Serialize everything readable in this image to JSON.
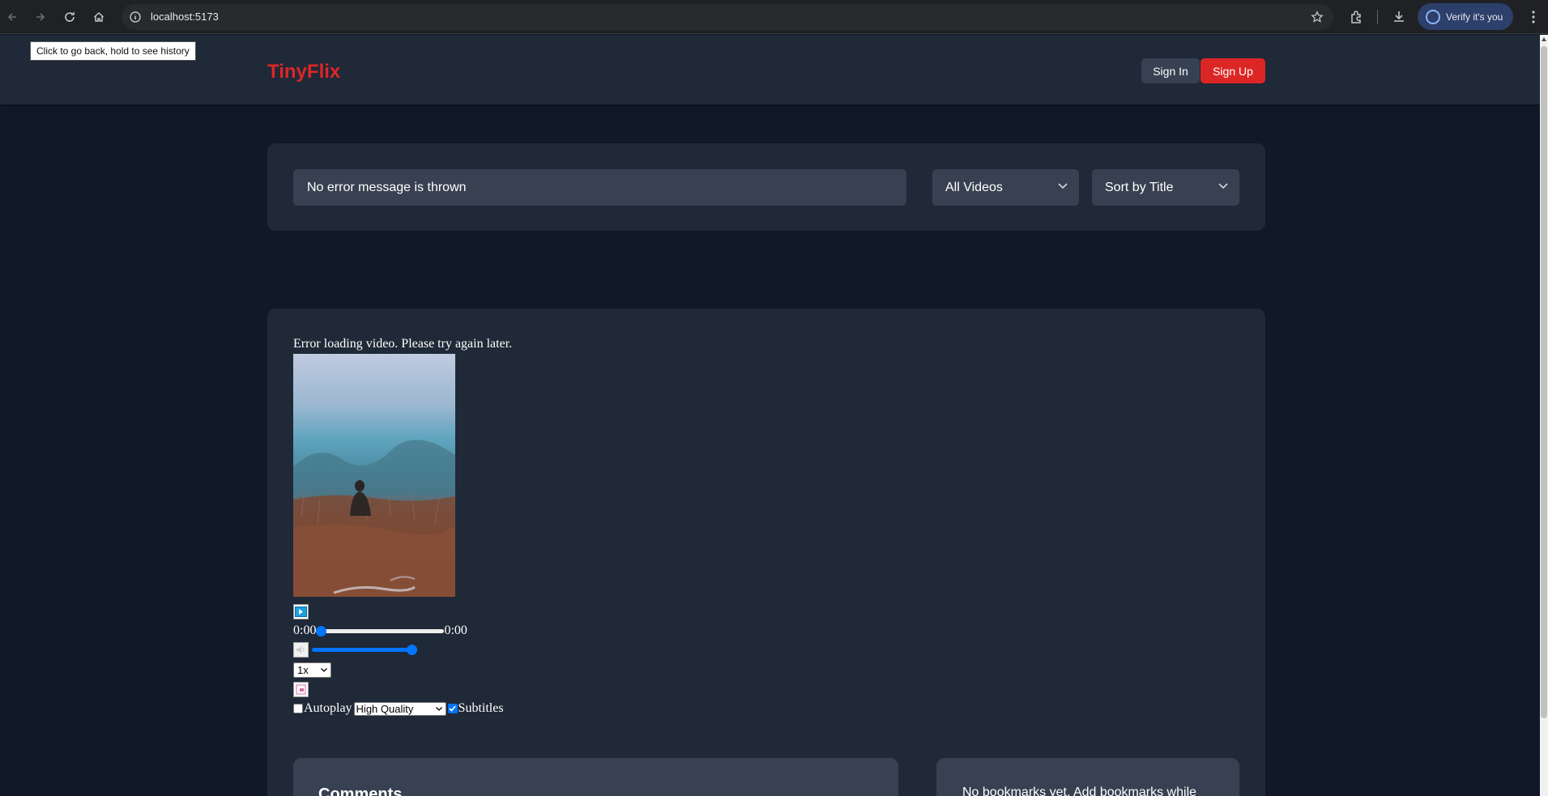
{
  "browser": {
    "url": "localhost:5173",
    "profile_label": "Verify it's you",
    "tooltip": "Click to go back, hold to see history"
  },
  "header": {
    "logo": "TinyFlix",
    "sign_in": "Sign In",
    "sign_up": "Sign Up"
  },
  "filters": {
    "search_value": "No error message is thrown",
    "category_selected": "All Videos",
    "sort_selected": "Sort by Title"
  },
  "player": {
    "error_message": "Error loading video. Please try again later.",
    "current_time": "0:00",
    "duration": "0:00",
    "progress": 0,
    "volume": 1,
    "speed_selected": "1x",
    "autoplay_label": "Autoplay",
    "autoplay_checked": false,
    "quality_selected": "High Quality",
    "subtitles_label": "Subtitles",
    "subtitles_checked": true
  },
  "comments": {
    "title": "Comments"
  },
  "bookmarks": {
    "empty_text": "No bookmarks yet. Add bookmarks while"
  },
  "colors": {
    "page_bg": "#111827",
    "card_bg": "#1f2937",
    "input_bg": "#374151",
    "brand_red": "#dc2626",
    "slider_blue": "#0075ff"
  }
}
